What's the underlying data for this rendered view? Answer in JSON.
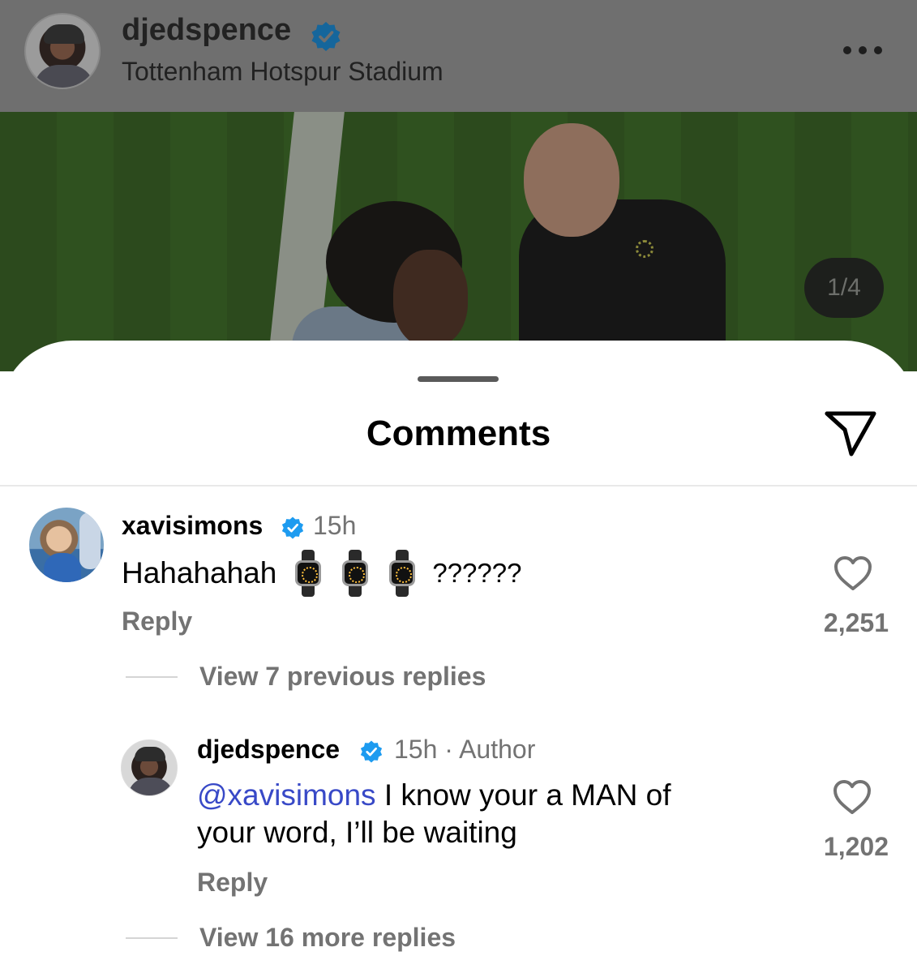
{
  "post_header": {
    "username": "djedspence",
    "location": "Tottenham Hotspur Stadium"
  },
  "photo": {
    "page_counter": "1/4"
  },
  "comments_sheet": {
    "title": "Comments",
    "comments": [
      {
        "username": "xavisimons",
        "time": "15h",
        "text": "Hahahahah",
        "emoji": [
          "watch-emoji",
          "watch-emoji",
          "watch-emoji"
        ],
        "text_suffix": "??????",
        "reply_label": "Reply",
        "likes": "2,251",
        "thread_label": "View 7 previous replies"
      },
      {
        "username": "djedspence",
        "time": "15h · Author",
        "mention": "@xavisimons",
        "text_line1": " I know your a MAN of",
        "text_line2": "your word, I’ll be waiting",
        "reply_label": "Reply",
        "likes": "1,202",
        "thread_label": "View 16 more replies"
      }
    ]
  },
  "colors": {
    "verified": "#1d9bf0",
    "mention": "#3849c7",
    "secondary_text": "#737373"
  }
}
